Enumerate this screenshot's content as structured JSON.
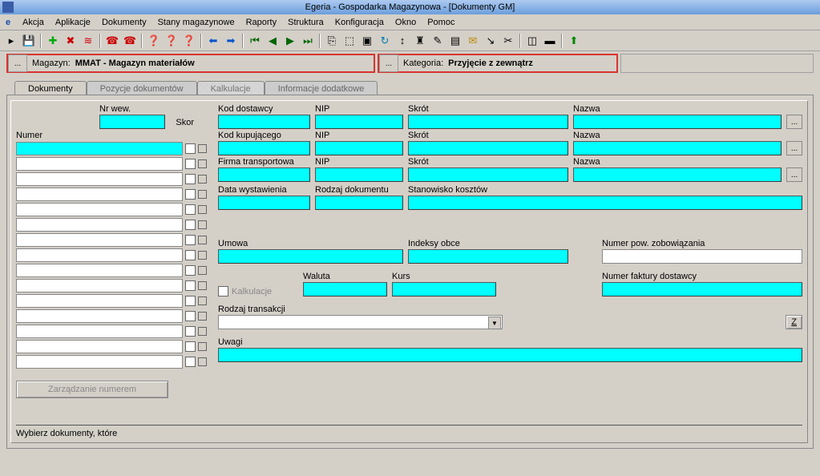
{
  "title": "Egeria - Gospodarka Magazynowa - [Dokumenty GM]",
  "menu": [
    "Akcja",
    "Aplikacje",
    "Dokumenty",
    "Stany magazynowe",
    "Raporty",
    "Struktura",
    "Konfiguracja",
    "Okno",
    "Pomoc"
  ],
  "header": {
    "magazyn_label": "Magazyn:",
    "magazyn_value": "MMAT - Magazyn materiałów",
    "kategoria_label": "Kategoria:",
    "kategoria_value": "Przyjęcie z zewnątrz"
  },
  "tabs": {
    "dokumenty": "Dokumenty",
    "pozycje": "Pozycje dokumentów",
    "kalkulacje": "Kalkulacje",
    "info": "Informacje dodatkowe"
  },
  "left": {
    "nrwew": "Nr wew.",
    "numer": "Numer",
    "skor": "Skor",
    "zarzadzanie": "Zarządzanie numerem"
  },
  "right": {
    "kod_dostawcy": "Kod dostawcy",
    "nip": "NIP",
    "skrot": "Skrót",
    "nazwa": "Nazwa",
    "kod_kupujacego": "Kod kupującego",
    "firma_transportowa": "Firma transportowa",
    "data_wystawienia": "Data wystawienia",
    "rodzaj_dokumentu": "Rodzaj dokumentu",
    "stanowisko_kosztow": "Stanowisko kosztów",
    "umowa": "Umowa",
    "indeksy_obce": "Indeksy obce",
    "numer_pow": "Numer pow. zobowiązania",
    "kalkulacje_chk": "Kalkulacje",
    "waluta": "Waluta",
    "kurs": "Kurs",
    "numer_faktury": "Numer faktury dostawcy",
    "rodzaj_transakcji": "Rodzaj transakcji",
    "z_btn": "Z",
    "uwagi": "Uwagi"
  },
  "bottom": {
    "wybierz": "Wybierz dokumenty, które"
  }
}
